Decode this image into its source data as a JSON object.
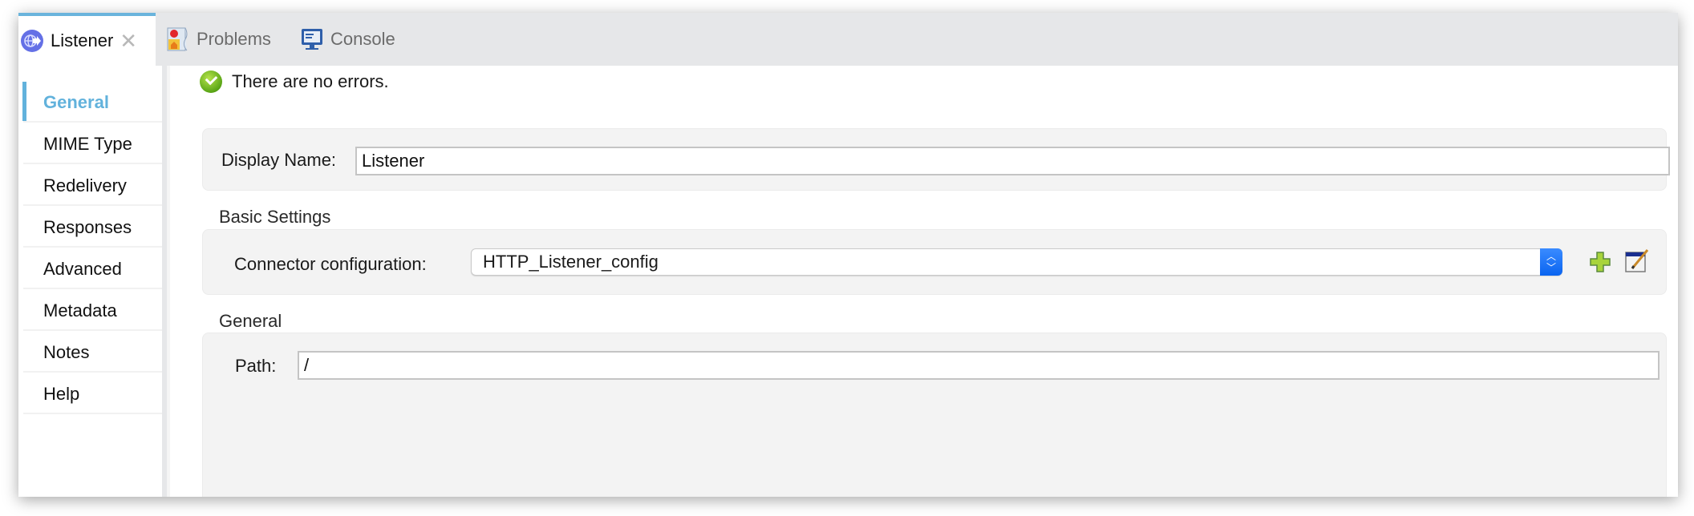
{
  "tabs": [
    {
      "label": "Listener",
      "icon": "listener-globe-icon",
      "active": true,
      "closable": true
    },
    {
      "label": "Problems",
      "icon": "problems-icon",
      "active": false
    },
    {
      "label": "Console",
      "icon": "console-monitor-icon",
      "active": false
    }
  ],
  "sidebar": {
    "items": [
      {
        "label": "General",
        "active": true
      },
      {
        "label": "MIME Type"
      },
      {
        "label": "Redelivery"
      },
      {
        "label": "Responses"
      },
      {
        "label": "Advanced"
      },
      {
        "label": "Metadata"
      },
      {
        "label": "Notes"
      },
      {
        "label": "Help"
      }
    ]
  },
  "status": {
    "text": "There are no errors.",
    "icon": "check-circle-icon"
  },
  "display_name": {
    "label": "Display Name:",
    "value": "Listener"
  },
  "basic_settings": {
    "title": "Basic Settings",
    "connector_label": "Connector configuration:",
    "connector_value": "HTTP_Listener_config",
    "add_icon": "plus-icon",
    "edit_icon": "edit-config-icon"
  },
  "general": {
    "title": "General",
    "path_label": "Path:",
    "path_value": "/"
  },
  "colors": {
    "accent": "#62b2dc",
    "select_blue": "#0a64f0"
  }
}
